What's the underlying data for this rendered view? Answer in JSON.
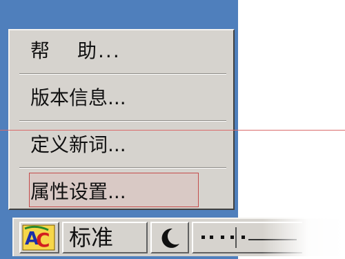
{
  "menu": {
    "items": [
      {
        "label_a": "帮",
        "label_b": "助..."
      },
      {
        "label": "版本信息..."
      },
      {
        "label": "定义新词..."
      },
      {
        "label": "属性设置..."
      }
    ]
  },
  "ime_bar": {
    "mode_label": "标准",
    "icons": [
      "ime-logo-icon",
      "half-moon-icon",
      "punctuation-icon"
    ]
  },
  "colors": {
    "desktop": "#4f7fbc",
    "menu_bg": "#d6d3ce",
    "highlight_border": "#c44a4a"
  }
}
